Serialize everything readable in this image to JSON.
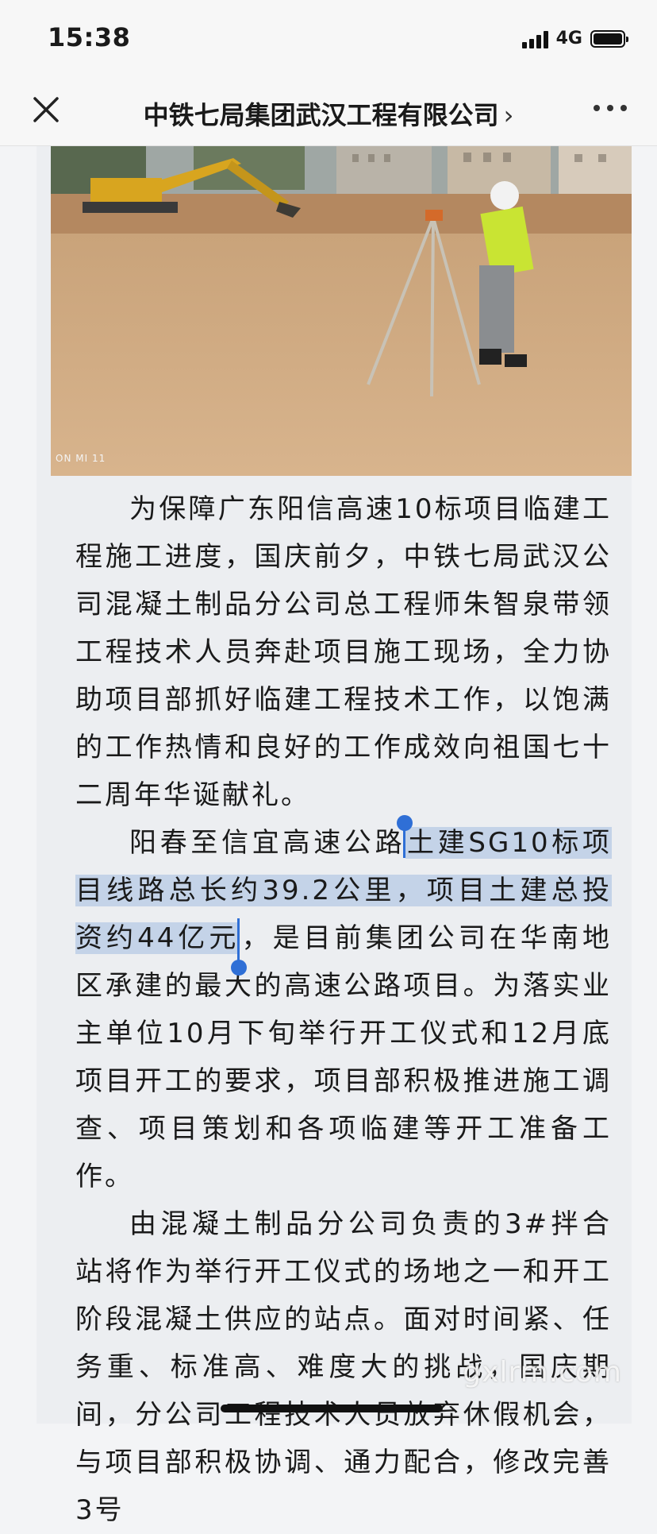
{
  "status_bar": {
    "time": "15:38",
    "network": "4G"
  },
  "nav": {
    "title": "中铁七局集团武汉工程有限公司",
    "chevron": "›"
  },
  "photo": {
    "camera_text": "ON MI 11"
  },
  "article": {
    "p1": "为保障广东阳信高速10标项目临建工程施工进度，国庆前夕，中铁七局武汉公司混凝土制品分公司总工程师朱智泉带领工程技术人员奔赴项目施工现场，全力协助项目部抓好临建工程技术工作，以饱满的工作热情和良好的工作成效向祖国七十二周年华诞献礼。",
    "p2_before": "阳春至信宜高速公路",
    "p2_selected": "土建SG10标项目线路总长约39.2公里，项目土建总投资约44亿元",
    "p2_after": "，是目前集团公司在华南地区承建的最大的高速公路项目。为落实业主单位10月下旬举行开工仪式和12月底项目开工的要求，项目部积极推进施工调查、项目策划和各项临建等开工准备工作。",
    "p3": "由混凝土制品分公司负责的3#拌合站将作为举行开工仪式的场地之一和开工阶段混凝土供应的站点。面对时间紧、任务重、标准高、难度大的挑战，国庆期间，分公司工程技术人员放弃休假机会，与项目部积极协调、通力配合，修改完善3号"
  },
  "watermark": "gxlrm.com",
  "icons": {
    "close": "close-icon",
    "more": "more-icon"
  },
  "colors": {
    "selection": "#c4d3e8",
    "handle": "#2f6fd6"
  }
}
